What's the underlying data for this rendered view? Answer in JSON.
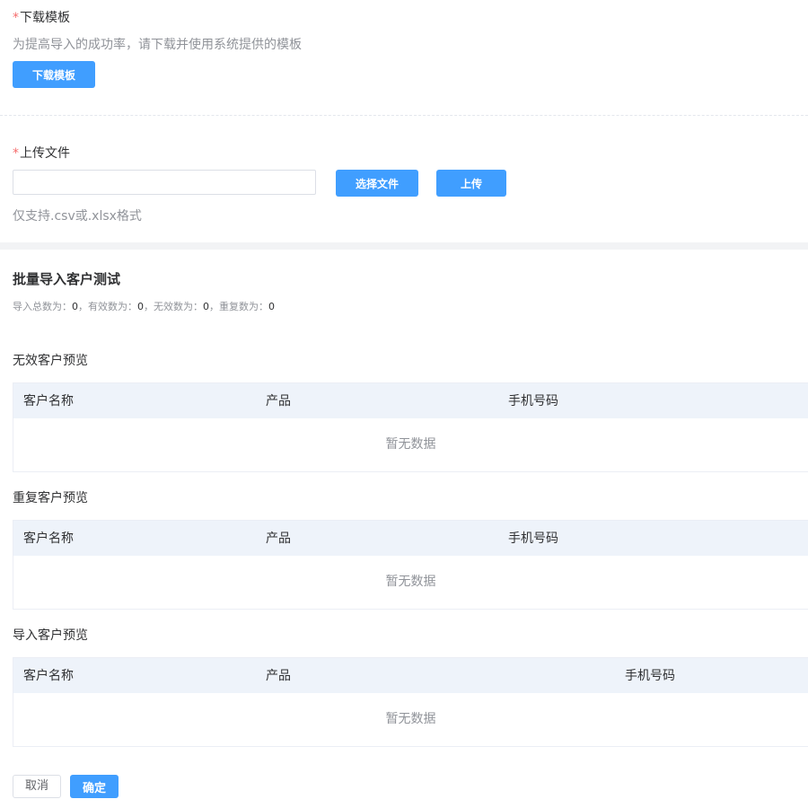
{
  "download": {
    "label": "下载模板",
    "required_mark": "*",
    "hint": "为提高导入的成功率，请下载并使用系统提供的模板",
    "button": "下载模板"
  },
  "upload": {
    "label": "上传文件",
    "required_mark": "*",
    "input_value": "",
    "select_button": "选择文件",
    "upload_button": "上传",
    "hint": "仅支持.csv或.xlsx格式"
  },
  "result": {
    "title": "批量导入客户测试",
    "stats": {
      "total_label": "导入总数为：",
      "total": "0",
      "valid_label": "，有效数为：",
      "valid": "0",
      "invalid_label": "，无效数为：",
      "invalid": "0",
      "duplicate_label": "，重复数为：",
      "duplicate": "0"
    }
  },
  "tables": [
    {
      "title": "无效客户预览",
      "columns": [
        "客户名称",
        "产品",
        "手机号码"
      ],
      "empty_text": "暂无数据"
    },
    {
      "title": "重复客户预览",
      "columns": [
        "客户名称",
        "产品",
        "手机号码"
      ],
      "empty_text": "暂无数据"
    },
    {
      "title": "导入客户预览",
      "columns": [
        "客户名称",
        "产品",
        "手机号码"
      ],
      "empty_text": "暂无数据"
    }
  ],
  "footer": {
    "cancel": "取消",
    "confirm": "确定"
  },
  "colors": {
    "primary": "#409eff",
    "required": "#f56c6c",
    "table_header": "#eef3fa",
    "hint": "#909399"
  }
}
